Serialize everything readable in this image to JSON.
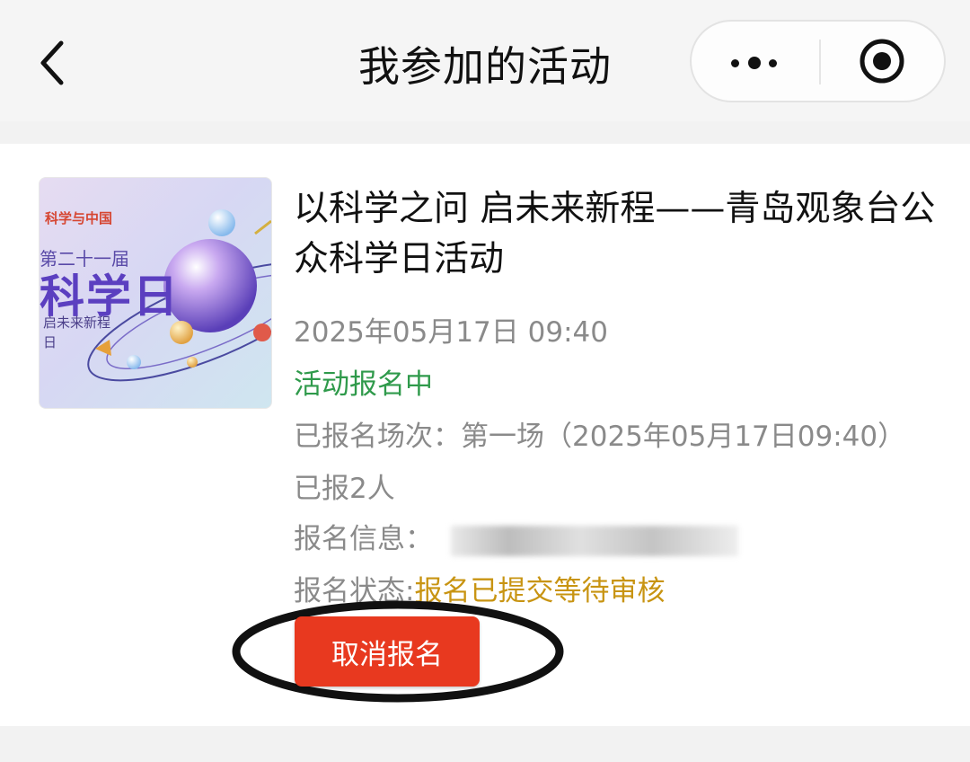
{
  "nav": {
    "title": "我参加的活动",
    "back_icon": "chevron-left-icon",
    "more_icon": "more-dots-icon",
    "close_icon": "target-circle-icon"
  },
  "activity": {
    "title": "以科学之问 启未来新程——青岛观象台公众科学日活动",
    "datetime": "2025年05月17日 09:40",
    "status": "活动报名中",
    "session_label": "已报名场次：",
    "session_value": "第一场（2025年05月17日09:40）",
    "registered_count": "已报2人",
    "info_label": "报名信息：",
    "state_label": "报名状态:",
    "state_value": "报名已提交等待审核",
    "cancel_button": "取消报名",
    "cover": {
      "logo_text": "科学与中国",
      "edition_text": "第二十一届",
      "big_text": "科学日",
      "sub_text": "启未来新程",
      "last_text": "日"
    }
  },
  "colors": {
    "status_green": "#2f9a4b",
    "state_gold": "#c89412",
    "button_red": "#e8391f"
  }
}
